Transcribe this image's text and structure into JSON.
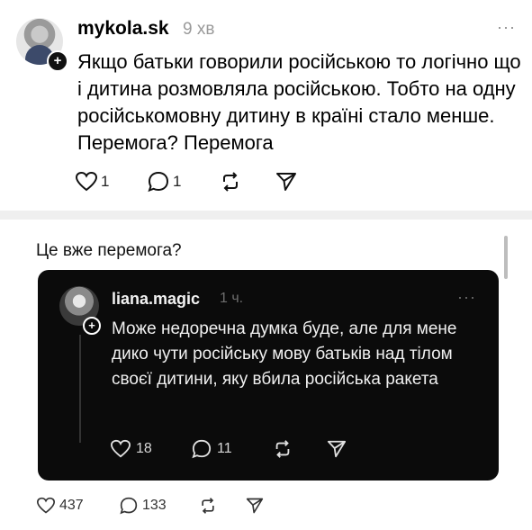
{
  "post": {
    "username": "mykola.sk",
    "time": "9 хв",
    "text": "Якщо батьки говорили російською то логічно що і дитина розмовляла російською. Тобто на одну російськомовну дитину в країні стало менше. Перемога? Перемога",
    "likes": "1",
    "replies": "1"
  },
  "quote": {
    "text": "Це вже перемога?",
    "likes": "437",
    "replies": "133"
  },
  "embedded": {
    "username": "liana.magic",
    "time": "1 ч.",
    "text": "Може недоречна думка буде, але для мене дико чути російську мову батьків над тілом своєї дитини, яку вбила російська ракета",
    "likes": "18",
    "replies": "11"
  },
  "icons": {
    "more": "more-dots-icon",
    "like": "heart-icon",
    "reply": "comment-icon",
    "repost": "repost-icon",
    "share": "send-icon",
    "follow": "plus-icon"
  },
  "colors": {
    "background": "#ffffff",
    "card": "#0b0b0b",
    "muted": "#9a9a9a"
  }
}
